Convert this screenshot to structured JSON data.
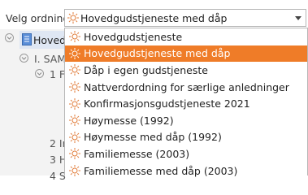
{
  "header": {
    "label": "Velg ordning",
    "combo_value": "Hovedgudstjeneste med dåp"
  },
  "tree": {
    "row1": "Hovedg",
    "row2": "I. SAM",
    "row3": "1 F",
    "row4": "2 In",
    "row5": "3 H",
    "row6": "4 S"
  },
  "dropdown": {
    "items": [
      {
        "label": "Hovedgudstjeneste"
      },
      {
        "label": "Hovedgudstjeneste med dåp"
      },
      {
        "label": "Dåp i egen gudstjeneste"
      },
      {
        "label": "Nattverdordning for særlige anledninger"
      },
      {
        "label": "Konfirmasjonsgudstjeneste 2021"
      },
      {
        "label": "Høymesse (1992)"
      },
      {
        "label": "Høymesse med dåp (1992)"
      },
      {
        "label": "Familiemesse (2003)"
      },
      {
        "label": "Familiemesse med dåp (2003)"
      }
    ],
    "selected_index": 1
  },
  "colors": {
    "accent": "#ef7c28",
    "icon": "#e07a36"
  }
}
